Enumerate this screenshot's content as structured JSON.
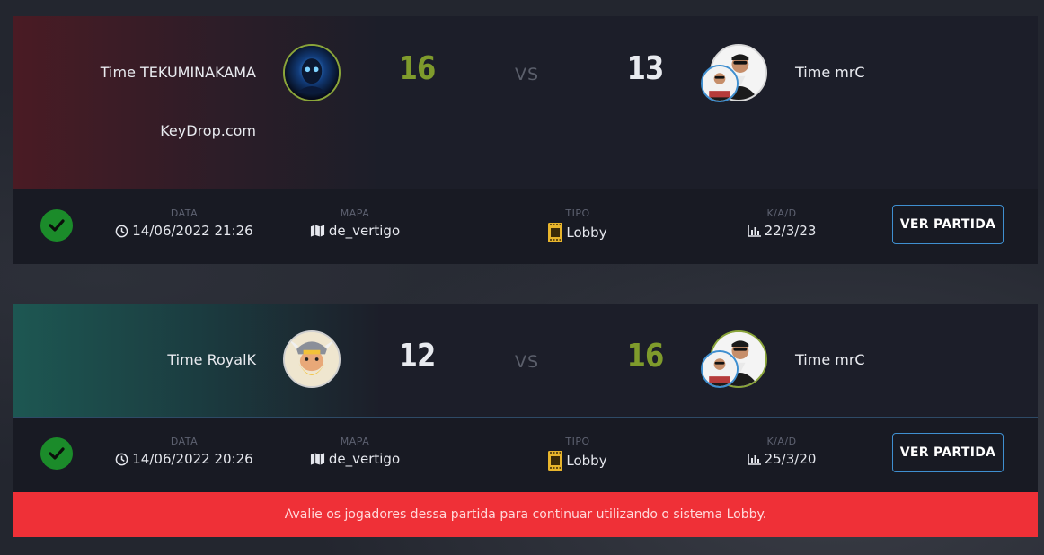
{
  "matches": [
    {
      "team_left": "Time TEKUMINAKAMA",
      "org_left": "KeyDrop.com",
      "score_left": "16",
      "vs": "VS",
      "score_right": "13",
      "team_right": "Time mrC",
      "info": {
        "date_label": "DATA",
        "date": "14/06/2022 21:26",
        "map_label": "MAPA",
        "map": "de_vertigo",
        "type_label": "TIPO",
        "type": "Lobby",
        "kad_label": "K/A/D",
        "kad": "22/3/23",
        "button": "VER PARTIDA"
      }
    },
    {
      "team_left": "Time RoyalK",
      "score_left": "12",
      "vs": "VS",
      "score_right": "16",
      "team_right": "Time mrC",
      "info": {
        "date_label": "DATA",
        "date": "14/06/2022 20:26",
        "map_label": "MAPA",
        "map": "de_vertigo",
        "type_label": "TIPO",
        "type": "Lobby",
        "kad_label": "K/A/D",
        "kad": "25/3/20",
        "button": "VER PARTIDA"
      },
      "alert": "Avalie os jogadores dessa partida para continuar utilizando o sistema Lobby."
    }
  ],
  "icons": {
    "result": "check-circle-icon",
    "date": "clock-icon",
    "map": "map-icon",
    "type": "ticket-icon",
    "kad": "bar-chart-icon"
  },
  "colors": {
    "win_score": "#7f9b2c",
    "lose_score": "#e8eaef",
    "button_border": "#3f8fd0",
    "alert_bg": "#ef3037",
    "check_bg": "#1b8b2a"
  }
}
